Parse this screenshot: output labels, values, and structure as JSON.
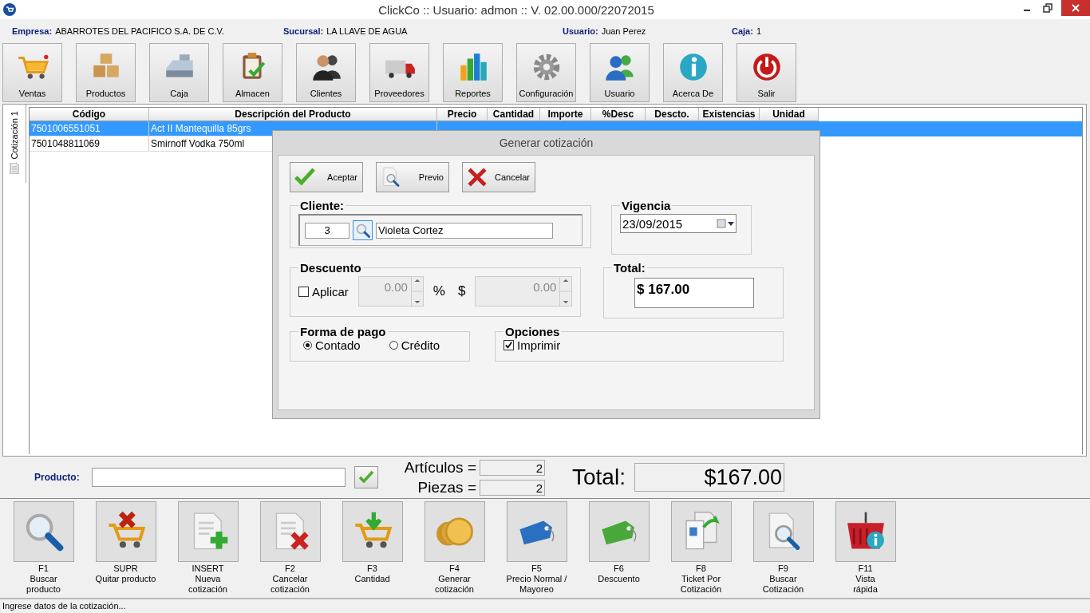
{
  "window": {
    "title": "ClickCo :: Usuario: admon :: V. 02.00.000/22072015"
  },
  "info_bar": [
    {
      "label": "Empresa:",
      "value": "ABARROTES DEL PACIFICO S.A. DE C.V."
    },
    {
      "label": "Sucursal:",
      "value": "LA LLAVE DE AGUA"
    },
    {
      "label": "Usuario:",
      "value": "Juan Perez"
    },
    {
      "label": "Caja:",
      "value": "1"
    }
  ],
  "toolbar": [
    {
      "label": "Ventas"
    },
    {
      "label": "Productos"
    },
    {
      "label": "Caja"
    },
    {
      "label": "Almacen"
    },
    {
      "label": "Clientes"
    },
    {
      "label": "Proveedores"
    },
    {
      "label": "Reportes"
    },
    {
      "label": "Configuración"
    },
    {
      "label": "Usuario"
    },
    {
      "label": "Acerca De"
    },
    {
      "label": "Salir"
    }
  ],
  "side_tab": {
    "label": "Cotización 1",
    "selected": true
  },
  "table": {
    "columns": [
      "Código",
      "Descripción del Producto",
      "Precio",
      "Cantidad",
      "Importe",
      "%Desc",
      "Descto.",
      "Existencias",
      "Unidad"
    ],
    "rows": [
      {
        "cells": [
          "7501006551051",
          "Act II Mantequilla 85grs"
        ],
        "selected": true
      },
      {
        "cells": [
          "7501048811069",
          "Smirnoff Vodka 750ml"
        ],
        "selected": false
      }
    ]
  },
  "dialog": {
    "title": "Generar cotización",
    "buttons": [
      {
        "label": "Aceptar"
      },
      {
        "label": "Previo"
      },
      {
        "label": "Cancelar"
      }
    ],
    "cliente": {
      "label": "Cliente:",
      "id": "3",
      "name": "Violeta Cortez"
    },
    "vigencia": {
      "label": "Vigencia",
      "date": "23/09/2015"
    },
    "descuento": {
      "label": "Descuento",
      "aplicar": {
        "label": "Aplicar",
        "checked": false
      },
      "percent": {
        "value": "0.00",
        "disabled": true
      },
      "percent_sign": "%",
      "dollar_sign": "$",
      "amount": {
        "value": "0.00",
        "disabled": true
      }
    },
    "total": {
      "label": "Total:",
      "value": "$ 167.00"
    },
    "forma_pago": {
      "label": "Forma de pago",
      "options": [
        {
          "label": "Contado",
          "selected": true
        },
        {
          "label": "Crédito",
          "selected": false
        }
      ]
    },
    "opciones": {
      "label": "Opciones",
      "imprimir": {
        "label": "Imprimir",
        "checked": true
      }
    }
  },
  "product_bar": {
    "label": "Producto:",
    "articulos": {
      "label": "Artículos =",
      "value": "2"
    },
    "piezas": {
      "label": "Piezas =",
      "value": "2"
    },
    "total": {
      "label": "Total:",
      "value": "$167.00"
    }
  },
  "function_keys": [
    {
      "key": "F1",
      "lines": [
        "Buscar",
        "producto"
      ]
    },
    {
      "key": "SUPR",
      "lines": [
        "Quitar producto"
      ]
    },
    {
      "key": "INSERT",
      "lines": [
        "Nueva",
        "cotización"
      ]
    },
    {
      "key": "F2",
      "lines": [
        "Cancelar",
        "cotización"
      ]
    },
    {
      "key": "F3",
      "lines": [
        "Cantidad"
      ]
    },
    {
      "key": "F4",
      "lines": [
        "Generar",
        "cotización"
      ]
    },
    {
      "key": "F5",
      "lines": [
        "Precio Normal /",
        "Mayoreo"
      ]
    },
    {
      "key": "F6",
      "lines": [
        "Descuento"
      ]
    },
    {
      "key": "F8",
      "lines": [
        "Ticket Por",
        "Cotización"
      ]
    },
    {
      "key": "F9",
      "lines": [
        "Buscar",
        "Cotización"
      ]
    },
    {
      "key": "F11",
      "lines": [
        "Vista",
        "rápida"
      ]
    }
  ],
  "status_bar": "Ingrese datos de la cotización..."
}
